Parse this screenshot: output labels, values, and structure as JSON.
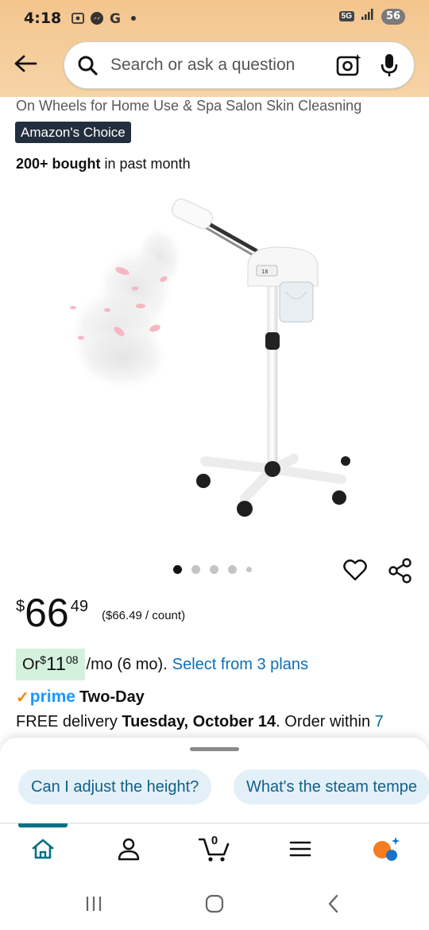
{
  "status": {
    "time": "4:18",
    "network": "5G",
    "battery": "56"
  },
  "search": {
    "placeholder": "Search or ask a question"
  },
  "product": {
    "title_line": "On Wheels for Home Use & Spa Salon Skin Cleasning",
    "badge": "Amazon's Choice",
    "bought_bold": "200+ bought",
    "bought_rest": " in past month",
    "image_alt": "Facial steamer on stand with wheels",
    "carousel": {
      "count": 5,
      "active_index": 0
    }
  },
  "price": {
    "currency": "$",
    "whole": "66",
    "fraction": "49",
    "unit": "($66.49 / count)"
  },
  "installment": {
    "or": "Or ",
    "currency": "$",
    "whole": "11",
    "fraction": "08",
    "rest": "/mo (6 mo).",
    "link": "Select from 3 plans"
  },
  "prime": {
    "logo": "prime",
    "speed": "Two-Day"
  },
  "delivery": {
    "prefix": "FREE delivery ",
    "date": "Tuesday, October 14",
    "middle": ". Order within ",
    "countdown": "7"
  },
  "rufus": {
    "suggestions": [
      "Can I adjust the height?",
      "What's the steam tempe"
    ]
  },
  "tabbar": {
    "cart_count": "0",
    "active": "home"
  },
  "colors": {
    "header": "#f3c58e",
    "link": "#0a6fb8",
    "prime_blue": "#1a98ff",
    "teal": "#007185",
    "badge_bg": "#232f3e",
    "install_bg": "#d4f1dd"
  }
}
